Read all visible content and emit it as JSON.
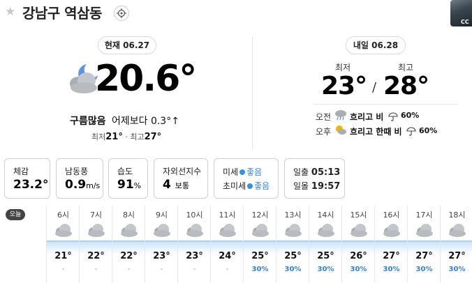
{
  "header": {
    "location": "강남구 역삼동"
  },
  "current": {
    "badge": "현재 06.27",
    "temp": "20.6°",
    "condition": "구름많음",
    "compare": "어제보다 0.3°↑",
    "min_label": "최저",
    "min": "21°",
    "sep": "·",
    "max_label": "최고",
    "max": "27°"
  },
  "tomorrow": {
    "badge": "내일 06.28",
    "min_label": "최저",
    "max_label": "최고",
    "min": "23°",
    "slash": "/",
    "max": "28°",
    "am_label": "오전",
    "am_desc": "흐리고 비",
    "am_pct": "60%",
    "pm_label": "오후",
    "pm_desc": "흐리고 한때 비",
    "pm_pct": "60%"
  },
  "info": {
    "feel_label": "체감",
    "feel": "23.2°",
    "wind_label": "남동풍",
    "wind_val": "0.9",
    "wind_unit": "m/s",
    "humid_label": "습도",
    "humid_val": "91",
    "humid_unit": "%",
    "uv_label": "자외선지수",
    "uv_val": "4",
    "uv_desc": "보통",
    "dust_label": "미세",
    "dust_val": "좋음",
    "fdust_label": "초미세",
    "fdust_val": "좋음",
    "sunrise_label": "일출",
    "sunrise": "05:13",
    "sunset_label": "일몰",
    "sunset": "19:57"
  },
  "hourly": {
    "today_label": "오늘",
    "hours": [
      {
        "h": "6시",
        "t": "21°",
        "p": "-"
      },
      {
        "h": "7시",
        "t": "22°",
        "p": "-"
      },
      {
        "h": "8시",
        "t": "22°",
        "p": "-"
      },
      {
        "h": "9시",
        "t": "23°",
        "p": "-"
      },
      {
        "h": "10시",
        "t": "23°",
        "p": "-"
      },
      {
        "h": "11시",
        "t": "24°",
        "p": "-"
      },
      {
        "h": "12시",
        "t": "25°",
        "p": "30%"
      },
      {
        "h": "13시",
        "t": "25°",
        "p": "30%"
      },
      {
        "h": "14시",
        "t": "25°",
        "p": "30%"
      },
      {
        "h": "15시",
        "t": "26°",
        "p": "30%"
      },
      {
        "h": "16시",
        "t": "27°",
        "p": "30%"
      },
      {
        "h": "17시",
        "t": "27°",
        "p": "30%"
      },
      {
        "h": "18시",
        "t": "27°",
        "p": "30%"
      }
    ]
  },
  "thumb_label": "CC",
  "colors": {
    "accent": "#2f7fe0",
    "dot": "#3a8de8",
    "border": "#cfcfcf"
  }
}
